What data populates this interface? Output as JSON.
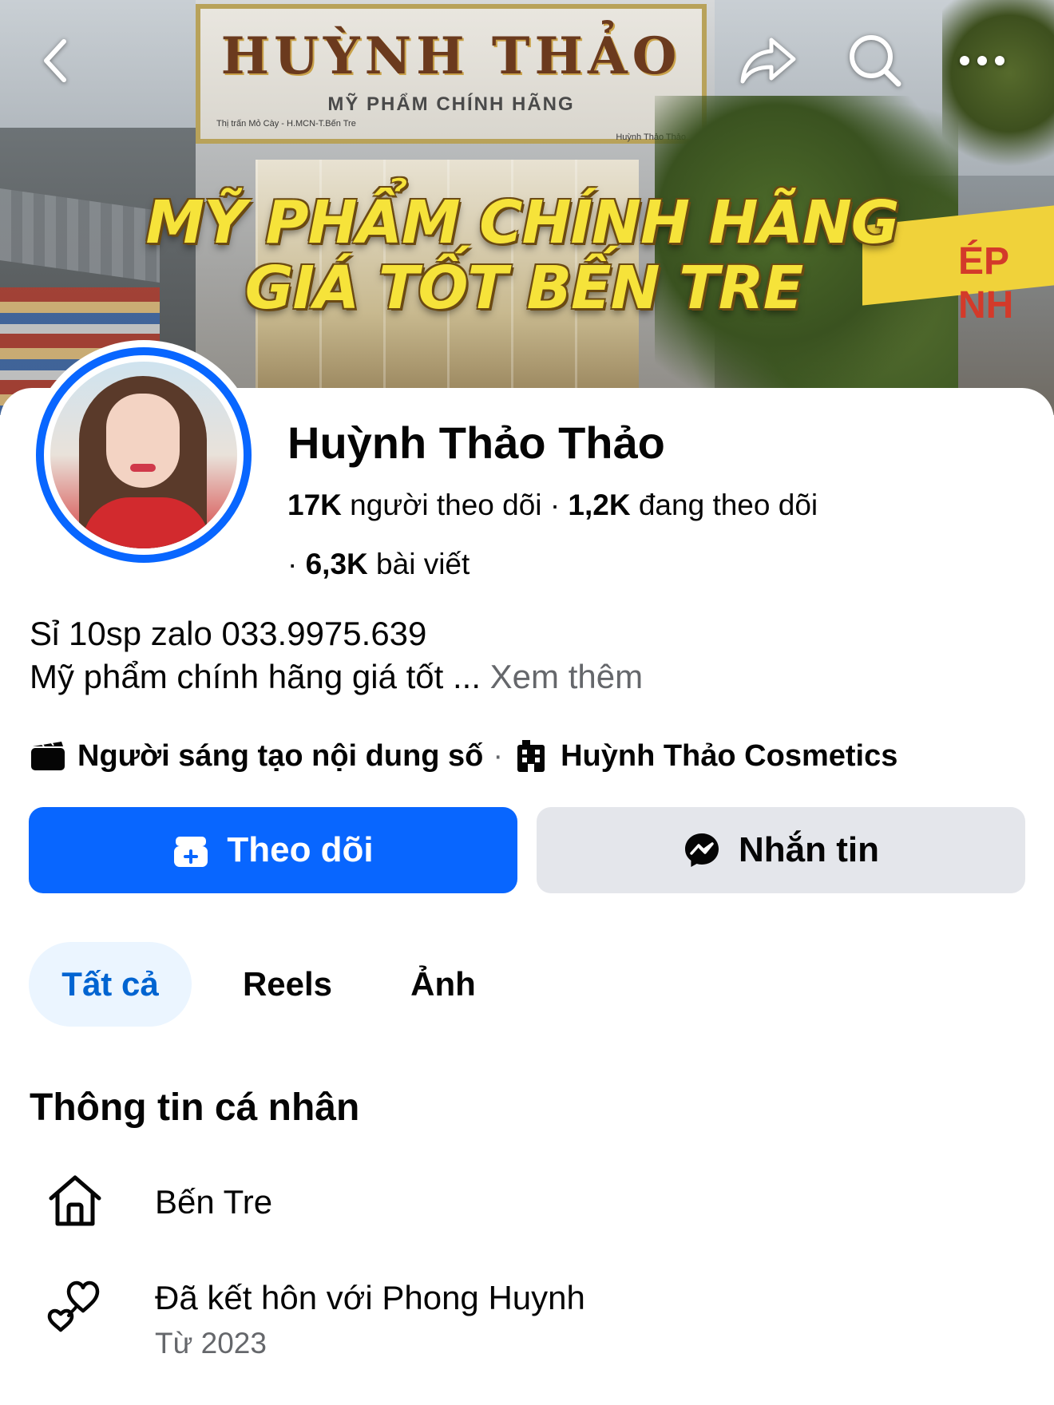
{
  "cover": {
    "sign_title": "HUỲNH THẢO",
    "sign_subtitle": "MỸ PHẨM CHÍNH HÃNG",
    "sign_address": "Thị trấn Mỏ Cày - H.MCN-T.Bến Tre",
    "sign_handle": "Huỳnh Thảo Thảo",
    "headline_line1": "MỸ PHẨM CHÍNH HÃNG",
    "headline_line2": "GIÁ TỐT BẾN TRE",
    "side_sign_text": "ÉP NH"
  },
  "topbar": {
    "back_icon": "chevron-left-icon",
    "share_icon": "share-arrow-icon",
    "search_icon": "search-icon",
    "more_icon": "more-horizontal-icon"
  },
  "profile": {
    "name": "Huỳnh Thảo Thảo",
    "followers_count": "17K",
    "followers_label": "người theo dõi",
    "following_count": "1,2K",
    "following_label": "đang theo dõi",
    "posts_count": "6,3K",
    "posts_label": "bài viết",
    "bio_line1": "Sỉ 10sp zalo 033.9975.639",
    "bio_line2": "Mỹ phẩm chính hãng giá tốt ...",
    "see_more": "Xem thêm",
    "category": "Người sáng tạo nội dung số",
    "business": "Huỳnh Thảo Cosmetics"
  },
  "actions": {
    "follow_label": "Theo dõi",
    "message_label": "Nhắn tin"
  },
  "tabs": [
    {
      "label": "Tất cả",
      "active": true
    },
    {
      "label": "Reels",
      "active": false
    },
    {
      "label": "Ảnh",
      "active": false
    }
  ],
  "about": {
    "title": "Thông tin cá nhân",
    "hometown": "Bến Tre",
    "relationship": "Đã kết hôn với Phong Huynh",
    "relationship_since": "Từ 2023"
  },
  "colors": {
    "accent": "#0866ff",
    "active_tab_bg": "#ebf5ff",
    "active_tab_text": "#0064d1",
    "secondary_button": "#e4e6eb",
    "muted_text": "#65676b"
  }
}
